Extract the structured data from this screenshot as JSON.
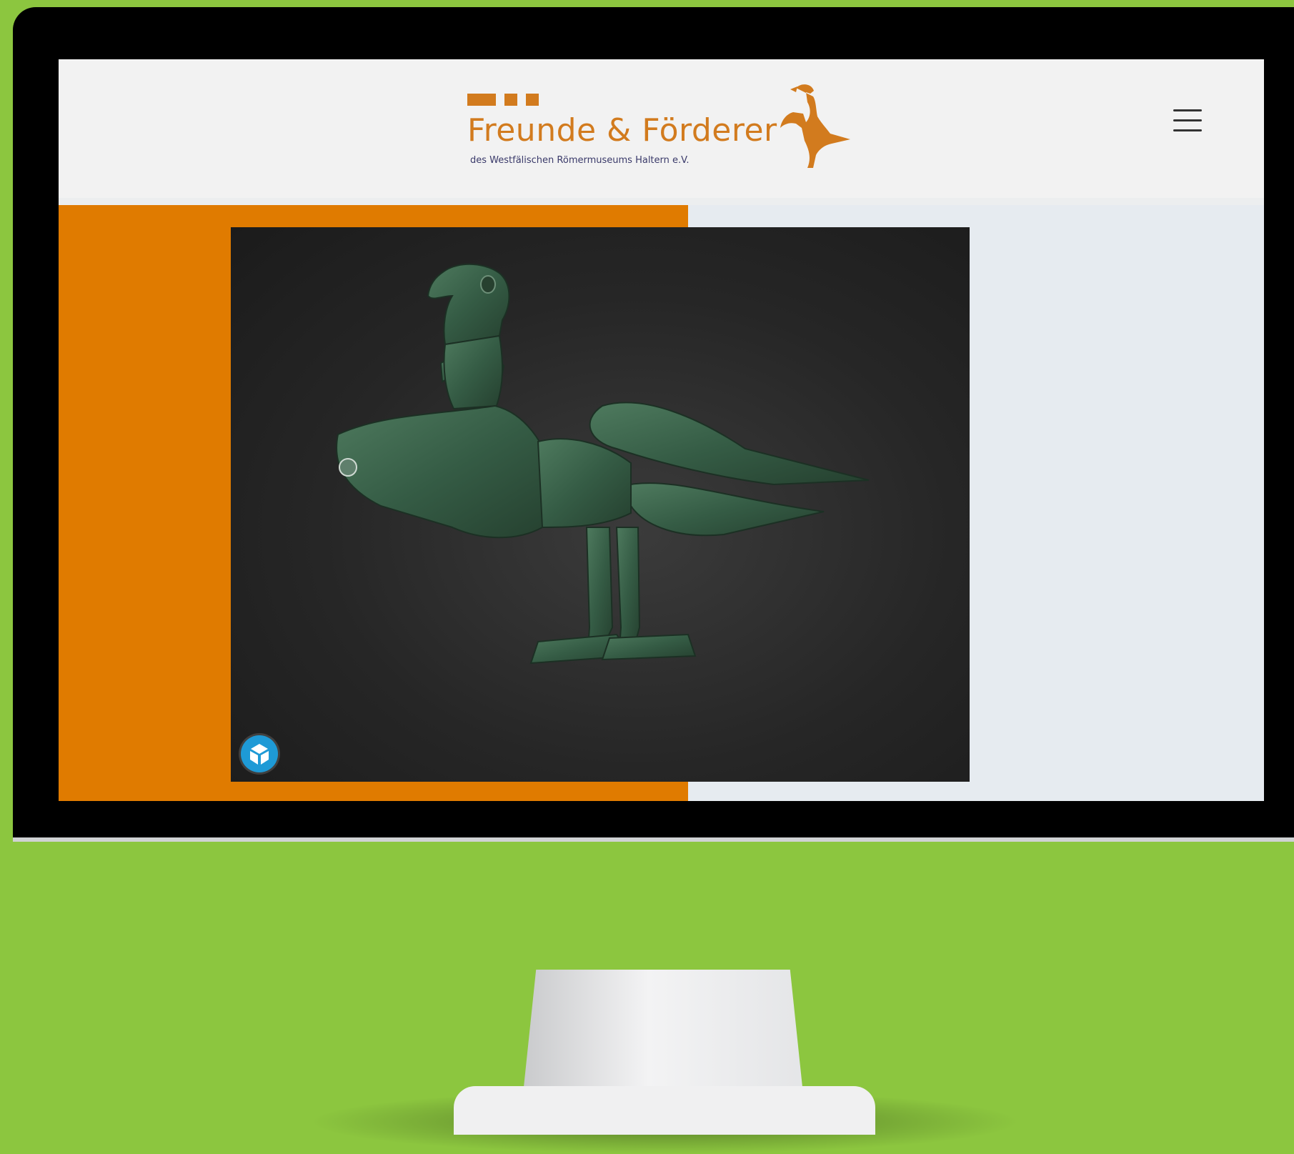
{
  "site": {
    "logo": {
      "title": "Freunde & Förderer",
      "subtitle": "des Westfälischen Römermuseums Haltern e.V.",
      "emblem": "eagle-emblem-icon"
    },
    "menu_icon": "hamburger-menu-icon"
  },
  "viewer": {
    "subject": "bronze eagle figurine 3D model",
    "badge_icon": "3d-model-icon"
  },
  "colors": {
    "background": "#8cc63f",
    "brand_orange": "#d27b1e",
    "hero_orange": "#e07b00",
    "viewer_badge": "#1e9ad6"
  }
}
